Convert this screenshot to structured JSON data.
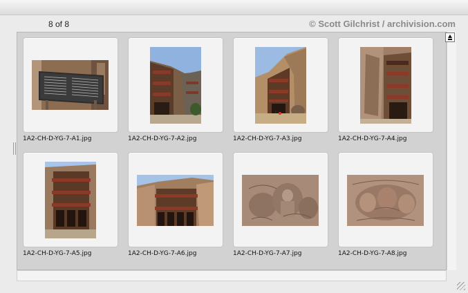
{
  "header": {
    "count_label": "8 of 8",
    "copyright": "© Scott Gilchrist / archivision.com"
  },
  "thumbnails": [
    {
      "filename": "1A2-CH-D-YG-7-A1.jpg"
    },
    {
      "filename": "1A2-CH-D-YG-7-A2.jpg"
    },
    {
      "filename": "1A2-CH-D-YG-7-A3.jpg"
    },
    {
      "filename": "1A2-CH-D-YG-7-A4.jpg"
    },
    {
      "filename": "1A2-CH-D-YG-7-A5.jpg"
    },
    {
      "filename": "1A2-CH-D-YG-7-A6.jpg"
    },
    {
      "filename": "1A2-CH-D-YG-7-A7.jpg"
    },
    {
      "filename": "1A2-CH-D-YG-7-A8.jpg"
    }
  ],
  "scrollbar": {
    "up_icon": "scroll-top-arrow-icon"
  }
}
